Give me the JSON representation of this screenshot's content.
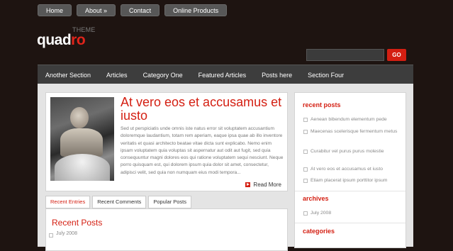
{
  "topnav": {
    "items": [
      "Home",
      "About »",
      "Contact",
      "Online Products"
    ]
  },
  "logo": {
    "theme": "THEME",
    "quad": "quad",
    "ro": "ro"
  },
  "search": {
    "value": "",
    "go_label": "GO"
  },
  "mainnav": {
    "items": [
      "Another Section",
      "Articles",
      "Category One",
      "Featured Articles",
      "Posts here",
      "Section Four"
    ]
  },
  "post": {
    "title": "At vero eos et accusamus et iusto",
    "body": "Sed ut perspiciatis unde omnis iste natus error sit voluptatem accusantium doloremque laudantium, totam rem aperiam, eaque ipsa quae ab illo inventore veritatis et quasi architecto beatae vitae dicta sunt explicabo. Nemo enim ipsam voluptatem quia voluptas sit aspernatur aut odit aut fugit, sed quia consequuntur magni dolores eos qui ratione voluptatem sequi nesciunt. Neque porro quisquam est, qui dolorem ipsum quia dolor sit amet, consectetur, adipisci velit, sed quia non numquam eius modi tempora...",
    "read_more": "Read More"
  },
  "tabs": [
    "Recent Entries",
    "Recent Comments",
    "Popular Posts"
  ],
  "recent_posts": {
    "heading": "Recent Posts",
    "items": [
      "July 2008"
    ]
  },
  "sidebar": {
    "recent_posts_heading": "recent posts",
    "recent_posts": [
      "Aenean bibendum elementum pede",
      "Maecenas scelerisque fermentum metus",
      "Curabitur vel purus purus molestie",
      "At vero eos et accusamus et iusto",
      "Etiam placerat ipsum porttitor ipsum"
    ],
    "archives_heading": "archives",
    "archives": [
      "July 2008"
    ],
    "categories_heading": "categories"
  },
  "colors": {
    "accent": "#d41f12",
    "background": "#1e1411",
    "nav": "#3d3d3d"
  }
}
